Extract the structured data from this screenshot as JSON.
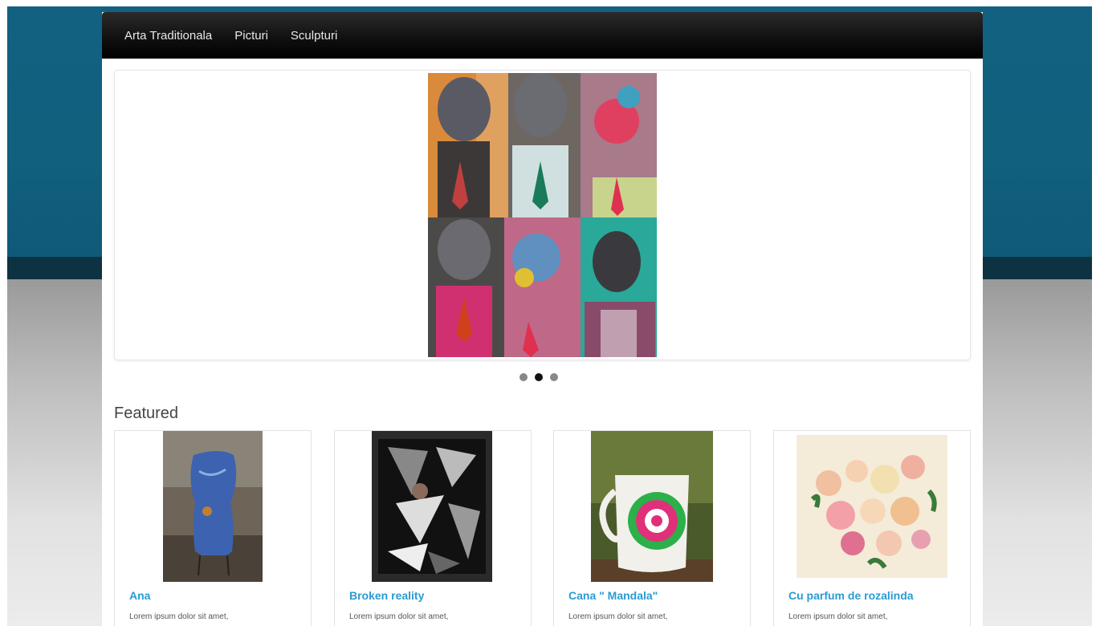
{
  "nav": {
    "items": [
      {
        "label": "Arta Traditionala"
      },
      {
        "label": "Picturi"
      },
      {
        "label": "Sculpturi"
      }
    ]
  },
  "carousel": {
    "active_index": 1,
    "slide_count": 3
  },
  "featured": {
    "title": "Featured",
    "cards": [
      {
        "title": "Ana",
        "text": "Lorem ipsum dolor sit amet,"
      },
      {
        "title": "Broken reality",
        "text": "Lorem ipsum dolor sit amet,"
      },
      {
        "title": "Cana \" Mandala\"",
        "text": "Lorem ipsum dolor sit amet,"
      },
      {
        "title": "Cu parfum de rozalinda",
        "text": "Lorem ipsum dolor sit amet,"
      }
    ]
  },
  "colors": {
    "header_bg": "#136180",
    "navbar_bg": "#000000",
    "link_blue": "#2a9bd3"
  }
}
